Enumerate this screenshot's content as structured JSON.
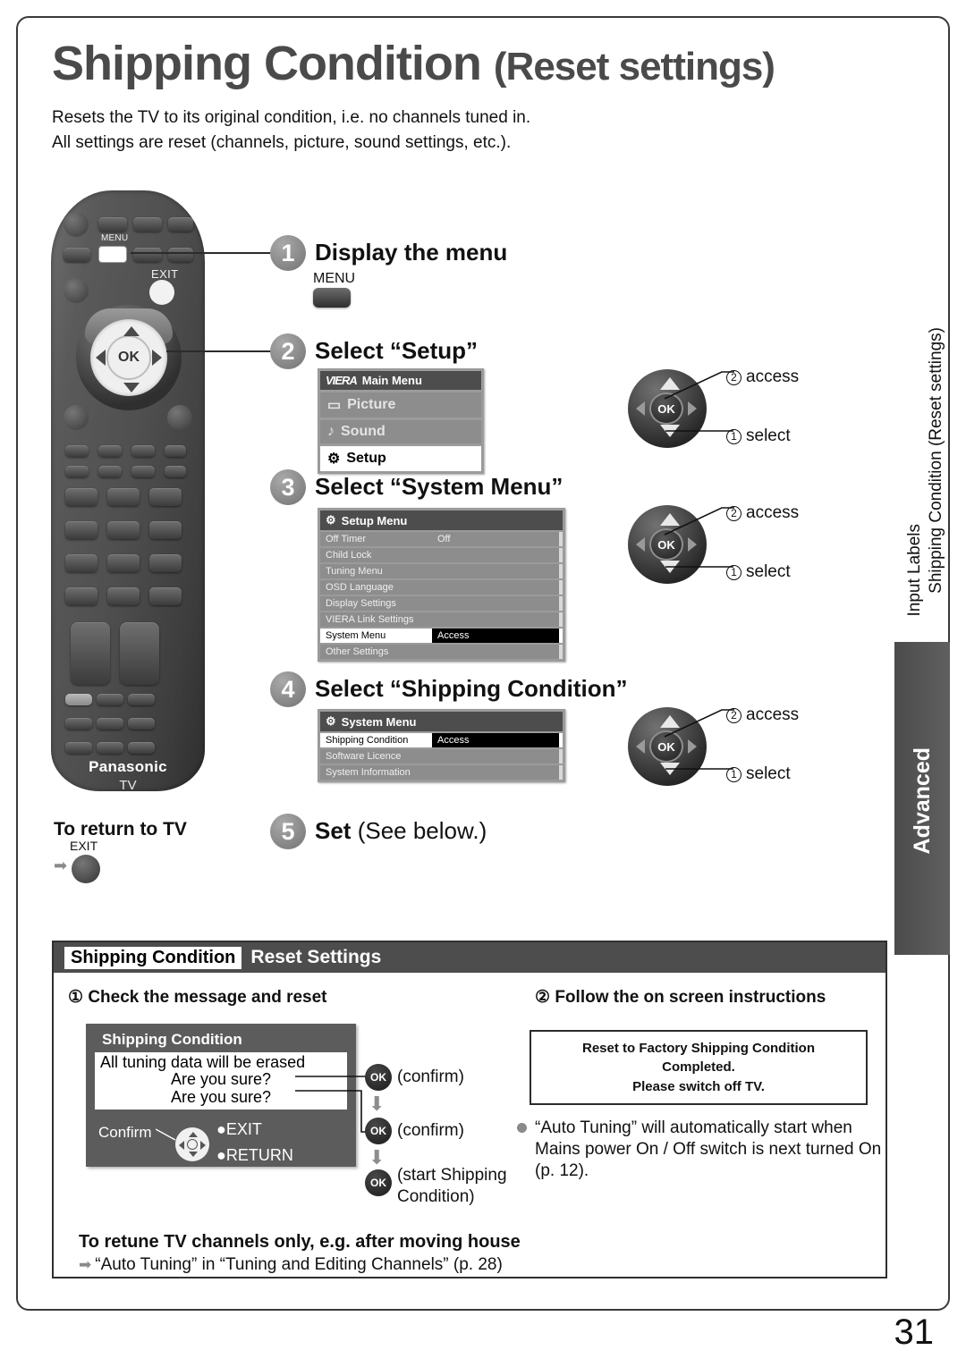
{
  "header": {
    "title_main": "Shipping Condition",
    "title_sub": "(Reset settings)",
    "intro_line1": "Resets the TV to its original condition, i.e. no channels tuned in.",
    "intro_line2": "All settings are reset (channels, picture, sound settings, etc.)."
  },
  "remote": {
    "menu_label": "MENU",
    "exit_label": "EXIT",
    "ok_label": "OK",
    "brand": "Panasonic",
    "brand_sub": "TV"
  },
  "steps": [
    {
      "num": "1",
      "title": "Display the menu",
      "button_label": "MENU"
    },
    {
      "num": "2",
      "title": "Select “Setup”"
    },
    {
      "num": "3",
      "title": "Select “System Menu”"
    },
    {
      "num": "4",
      "title": "Select “Shipping Condition”"
    },
    {
      "num": "5",
      "title_bold": "Set",
      "title_reg": "(See below.)"
    }
  ],
  "main_menu": {
    "brand": "VIERA",
    "heading": "Main Menu",
    "items": [
      {
        "label": "Picture",
        "selected": false
      },
      {
        "label": "Sound",
        "selected": false
      },
      {
        "label": "Setup",
        "selected": true
      }
    ]
  },
  "setup_menu": {
    "heading": "Setup Menu",
    "rows": [
      {
        "name": "Off Timer",
        "value": "Off",
        "selected": false
      },
      {
        "name": "Child Lock",
        "value": "",
        "selected": false
      },
      {
        "name": "Tuning Menu",
        "value": "",
        "selected": false
      },
      {
        "name": "OSD Language",
        "value": "",
        "selected": false
      },
      {
        "name": "Display Settings",
        "value": "",
        "selected": false
      },
      {
        "name": "VIERA Link Settings",
        "value": "",
        "selected": false
      },
      {
        "name": "System Menu",
        "value": "Access",
        "selected": true
      },
      {
        "name": "Other Settings",
        "value": "",
        "selected": false
      }
    ]
  },
  "system_menu": {
    "heading": "System Menu",
    "rows": [
      {
        "name": "Shipping Condition",
        "value": "Access",
        "selected": true
      },
      {
        "name": "Software Licence",
        "value": "",
        "selected": false
      },
      {
        "name": "System Information",
        "value": "",
        "selected": false
      }
    ]
  },
  "dpad_callouts": {
    "ok_label": "OK",
    "access_num": "2",
    "access_label": "access",
    "select_num": "1",
    "select_label": "select"
  },
  "return_to_tv": {
    "heading": "To return to TV",
    "button_label": "EXIT"
  },
  "sidebar": {
    "vertical_line1": "Input Labels",
    "vertical_line2": "Shipping Condition (Reset settings)",
    "tab_label": "Advanced"
  },
  "panel": {
    "chip": "Shipping Condition",
    "title": "Reset Settings",
    "step1_num": "①",
    "step1_label": "Check the message and reset",
    "step2_num": "②",
    "step2_label": "Follow the on screen instructions",
    "tv_dialog": {
      "title": "Shipping Condition",
      "msg_line1": "All tuning data will be erased",
      "msg_line2": "Are you sure?",
      "msg_line3": "Are you sure?",
      "confirm_label": "Confirm",
      "exit_label": "EXIT",
      "return_label": "RETURN"
    },
    "ok_steps": [
      {
        "ok": "OK",
        "caption": "(confirm)"
      },
      {
        "ok": "OK",
        "caption": "(confirm)"
      },
      {
        "ok": "OK",
        "caption_l1": "(start Shipping",
        "caption_l2": "Condition)"
      }
    ],
    "message_box": {
      "line1": "Reset to Factory Shipping Condition",
      "line2": "Completed.",
      "line3": "Please switch off TV."
    },
    "bullet_note": "“Auto Tuning” will automatically start when Mains power On / Off switch is next turned On (p. 12).",
    "retune_heading": "To retune TV channels only, e.g. after moving house",
    "retune_line": "“Auto Tuning” in “Tuning and Editing Channels” (p. 28)"
  },
  "page_number": "31"
}
